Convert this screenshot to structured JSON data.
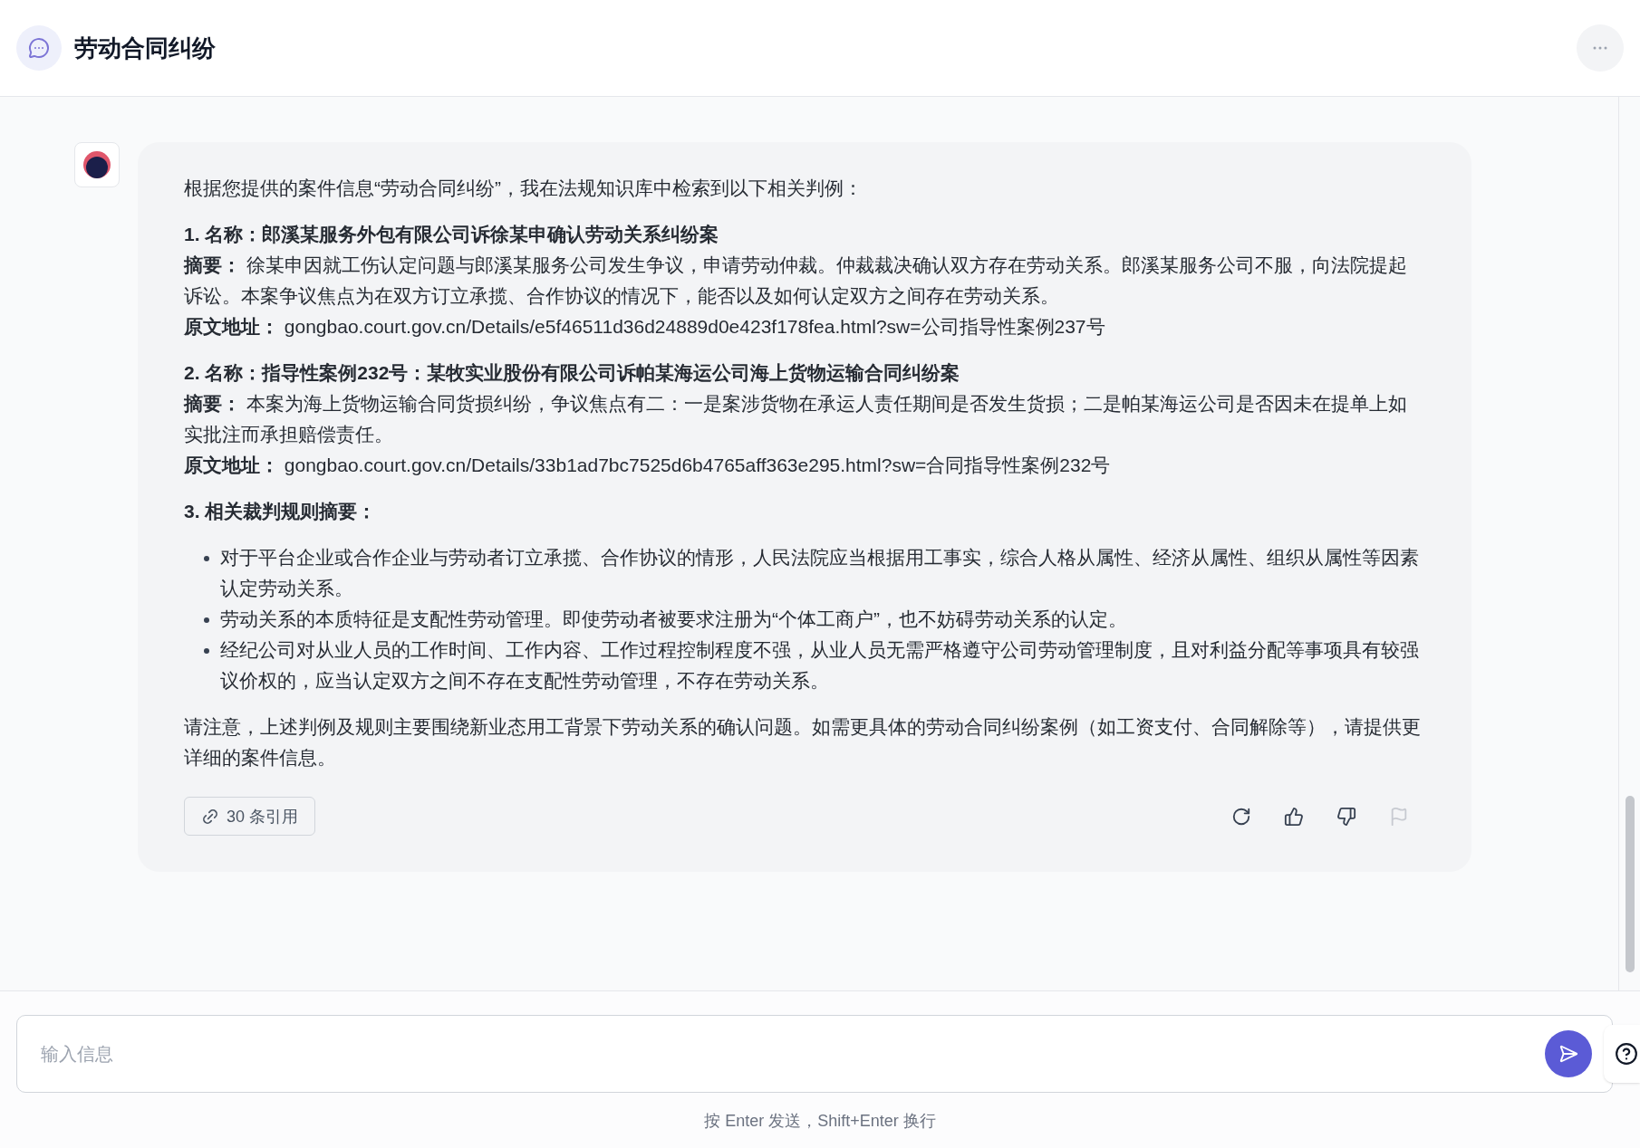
{
  "header": {
    "title": "劳动合同纠纷"
  },
  "message": {
    "blocks": [
      {
        "kind": "paragraph",
        "text": "根据您提供的案件信息“劳动合同纠纷”，我在法规知识库中检索到以下相关判例："
      },
      {
        "kind": "case",
        "lines": [
          "1. 名称：郎溪某服务外包有限公司诉徐某申确认劳动关系纠纷案",
          "**摘要：** 徐某申因就工伤认定问题与郎溪某服务公司发生争议，申请劳动仲裁。仲裁裁决确认双方存在劳动关系。郎溪某服务公司不服，向法院提起诉讼。本案争议焦点为在双方订立承揽、合作协议的情况下，能否以及如何认定双方之间存在劳动关系。",
          "**原文地址：** gongbao.court.gov.cn/Details/e5f46511d36d24889d0e423f178fea.html?sw=公司指导性案例237号"
        ]
      },
      {
        "kind": "case",
        "lines": [
          "2. 名称：指导性案例232号：某牧实业股份有限公司诉帕某海运公司海上货物运输合同纠纷案",
          "**摘要：** 本案为海上货物运输合同货损纠纷，争议焦点有二：一是案涉货物在承运人责任期间是否发生货损；二是帕某海运公司是否因未在提单上如实批注而承担赔偿责任。",
          "**原文地址：** gongbao.court.gov.cn/Details/33b1ad7bc7525d6b4765aff363e295.html?sw=合同指导性案例232号"
        ]
      },
      {
        "kind": "heading",
        "text": "3. 相关裁判规则摘要："
      },
      {
        "kind": "bullets",
        "items": [
          "对于平台企业或合作企业与劳动者订立承揽、合作协议的情形，人民法院应当根据用工事实，综合人格从属性、经济从属性、组织从属性等因素认定劳动关系。",
          "劳动关系的本质特征是支配性劳动管理。即使劳动者被要求注册为“个体工商户”，也不妨碍劳动关系的认定。",
          "经纪公司对从业人员的工作时间、工作内容、工作过程控制程度不强，从业人员无需严格遵守公司劳动管理制度，且对利益分配等事项具有较强议价权的，应当认定双方之间不存在支配性劳动管理，不存在劳动关系。"
        ]
      },
      {
        "kind": "paragraph",
        "text": "请注意，上述判例及规则主要围绕新业态用工背景下劳动关系的确认问题。如需更具体的劳动合同纠纷案例（如工资支付、合同解除等），请提供更详细的案件信息。"
      }
    ],
    "citations": "30 条引用",
    "actions": [
      {
        "kind": "regenerate",
        "disabled": false
      },
      {
        "kind": "like",
        "disabled": false
      },
      {
        "kind": "dislike",
        "disabled": false
      },
      {
        "kind": "report",
        "disabled": true
      }
    ]
  },
  "composer": {
    "placeholder": "输入信息",
    "hint": "按 Enter 发送，Shift+Enter 换行"
  }
}
